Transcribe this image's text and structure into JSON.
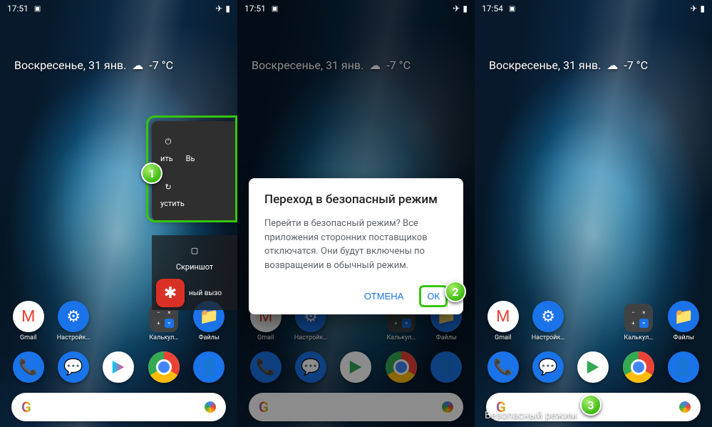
{
  "status": {
    "time1": "17:51",
    "time3": "17:54",
    "airplane": "✈",
    "battery": "▮"
  },
  "weather": {
    "date": "Воскресенье, 31 янв.",
    "temp": "-7 °C",
    "cloud": "☁"
  },
  "power_menu": {
    "poweroff_label_partial": "ить",
    "poweron_label_partial": "Вь",
    "restart_label_partial": "устить",
    "screenshot": "Скриншот",
    "emergency_partial": "ный вызо"
  },
  "dialog": {
    "title": "Переход в безопасный режим",
    "body": "Перейти в безопасный режим? Все приложения сторонних поставщиков отключатся. Они будут включены по возвращении в обычный режим.",
    "cancel": "Отмена",
    "ok": "ОК"
  },
  "apps": {
    "gmail": "Gmail",
    "settings": "Настройк…",
    "calculator": "Калькул…",
    "files": "Файлы"
  },
  "safe_mode_label": "Безопасный режим",
  "search": {
    "placeholder": ""
  },
  "badges": {
    "b1": "1",
    "b2": "2",
    "b3": "3"
  },
  "glyphs": {
    "power": "⏻",
    "restart": "↻",
    "screenshot": "▢",
    "emergency": "✱",
    "phone": "📞",
    "message": "💬",
    "play": "▶",
    "contact": "👤",
    "mail": "M",
    "gear": "⚙",
    "folder": "📁",
    "photo": "▣"
  }
}
